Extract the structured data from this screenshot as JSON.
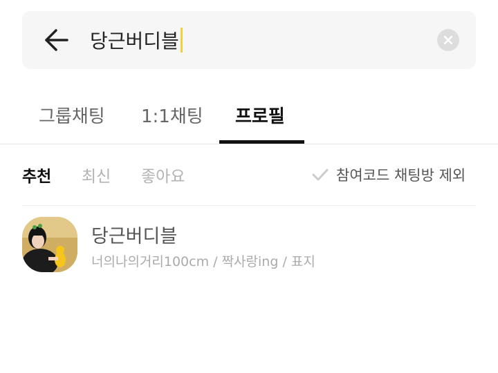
{
  "search": {
    "value": "당근버디블",
    "caret_color": "#f0d13c"
  },
  "icons": {
    "back": "arrow-left-icon",
    "clear": "close-circle-icon",
    "check": "check-icon"
  },
  "tabs": [
    {
      "label": "그룹채팅",
      "active": false
    },
    {
      "label": "1:1채팅",
      "active": false
    },
    {
      "label": "프로필",
      "active": true
    }
  ],
  "filters": {
    "sort": [
      {
        "label": "추천",
        "active": true
      },
      {
        "label": "최신",
        "active": false
      },
      {
        "label": "좋아요",
        "active": false
      }
    ],
    "exclude_label": "참여코드 채팅방 제외"
  },
  "results": [
    {
      "name": "당근버디블",
      "description": "너의나의거리100cm / 짝사랑ing / 표지"
    }
  ]
}
